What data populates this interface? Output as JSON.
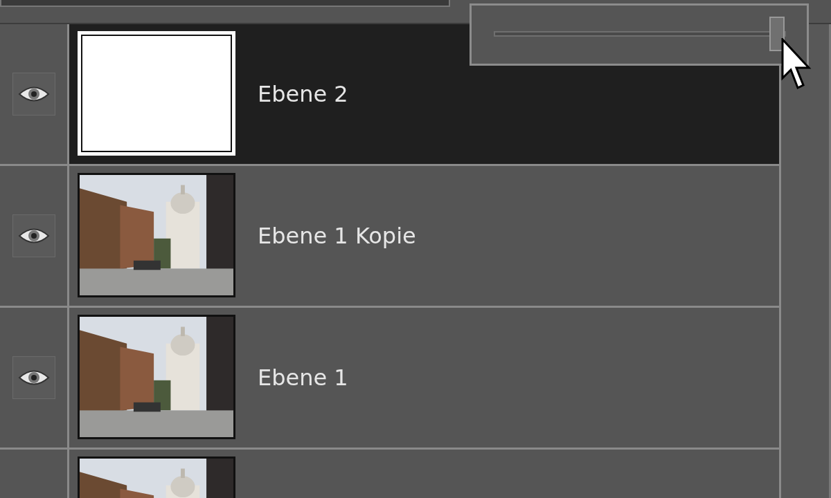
{
  "opacity_slider": {
    "level": 0.97
  },
  "layers": [
    {
      "name": "Ebene 2",
      "visible": true,
      "selected": true,
      "kind": "blank"
    },
    {
      "name": "Ebene 1 Kopie",
      "visible": true,
      "selected": false,
      "kind": "picture"
    },
    {
      "name": "Ebene 1",
      "visible": true,
      "selected": false,
      "kind": "picture"
    },
    {
      "selected": false,
      "kind": "picture"
    }
  ]
}
